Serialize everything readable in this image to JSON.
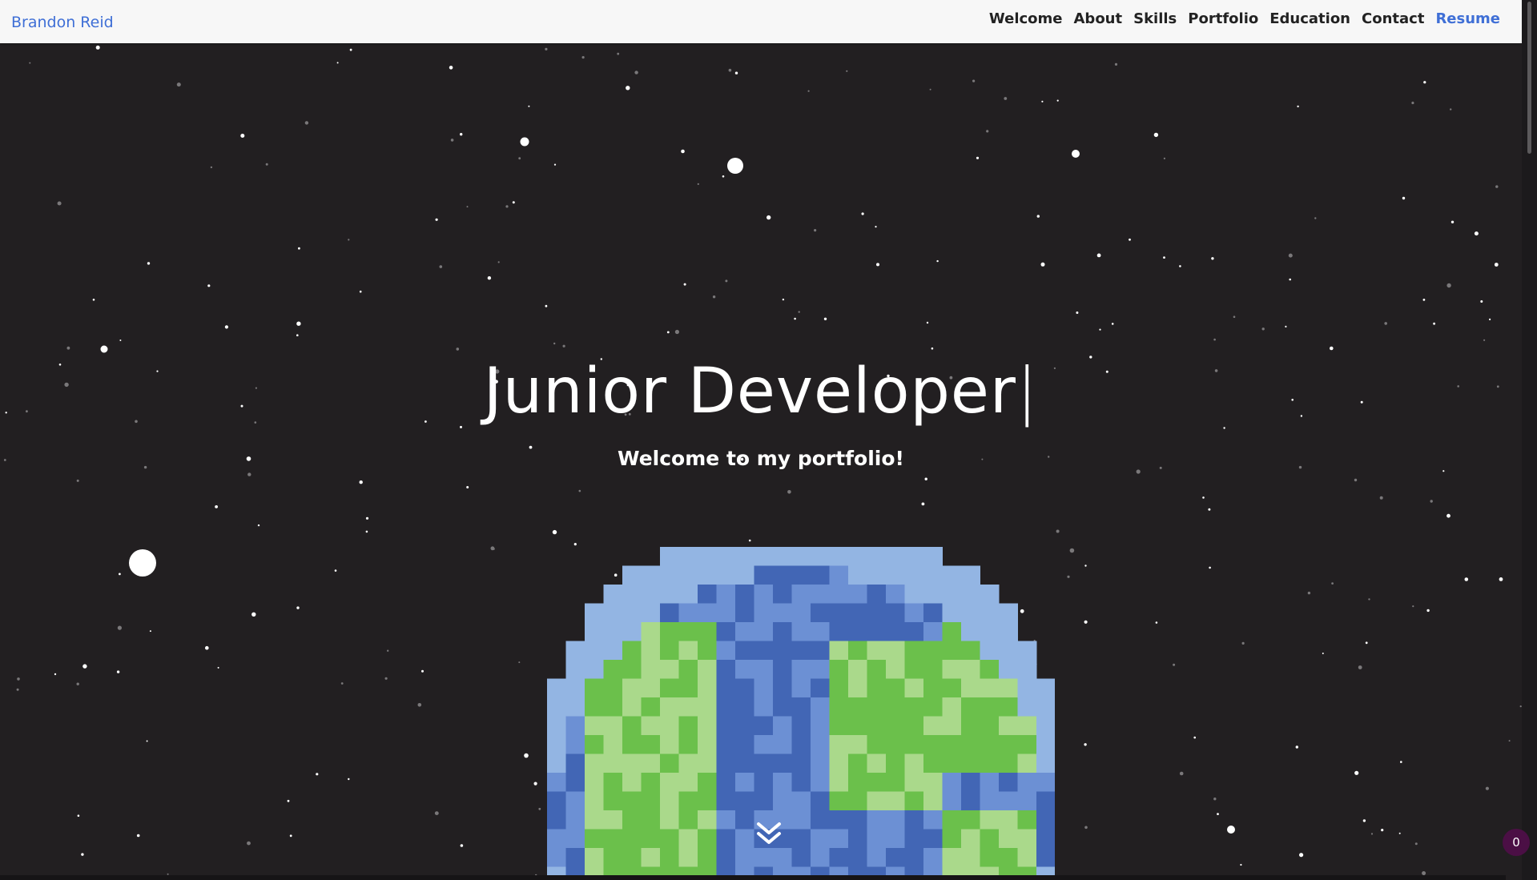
{
  "navbar": {
    "brand": "Brandon Reid",
    "links": [
      "Welcome",
      "About",
      "Skills",
      "Portfolio",
      "Education",
      "Contact"
    ],
    "resume_label": "Resume"
  },
  "hero": {
    "headline": "Junior Developer",
    "cursor": "|",
    "subtitle": "Welcome to my portfolio!",
    "scroll_icon": "double-chevron-down-icon"
  },
  "badge": {
    "count": "0"
  },
  "colors": {
    "background": "#221f21",
    "navbar_bg": "#f7f7f7",
    "accent_blue": "#3f6fd6",
    "ocean_dark": "#4266b5",
    "ocean_mid": "#6c90d4",
    "ocean_light": "#93b5e3",
    "land_green": "#6bc04b",
    "land_light": "#aad98b",
    "badge_bg": "#4b0f45"
  }
}
